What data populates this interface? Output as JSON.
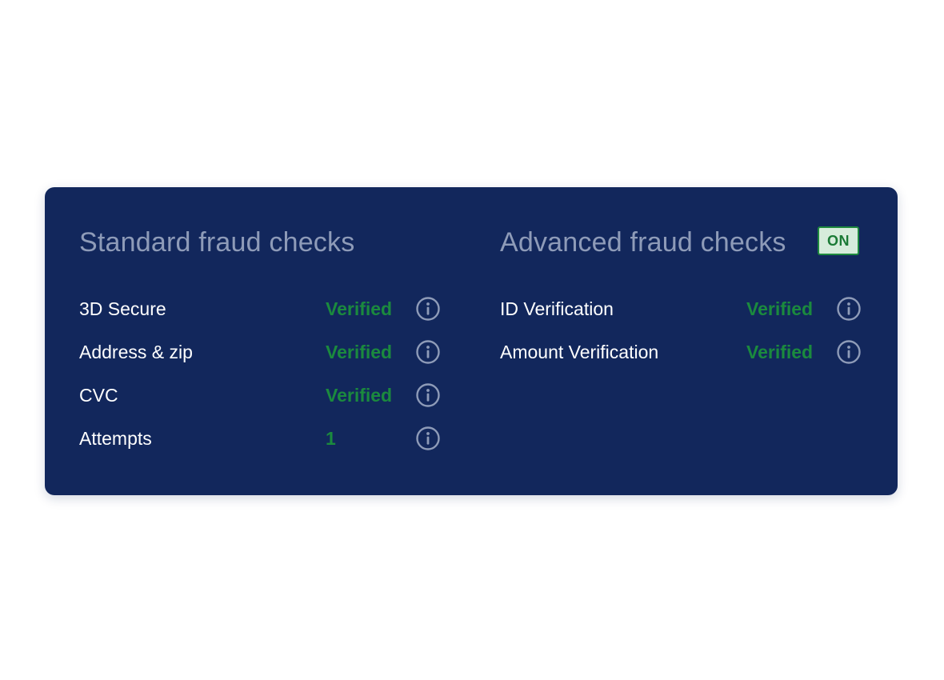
{
  "colors": {
    "card_background": "#12275c",
    "title_text": "#8e9bb8",
    "label_text": "#ffffff",
    "verified_green": "#1b8a3e",
    "toggle_background": "#d6ecdb",
    "toggle_border": "#1f8a3e",
    "info_icon": "#8e9bb8"
  },
  "standard": {
    "title": "Standard fraud checks",
    "rows": [
      {
        "label": "3D Secure",
        "value": "Verified",
        "icon": "info-icon"
      },
      {
        "label": "Address & zip",
        "value": "Verified",
        "icon": "info-icon"
      },
      {
        "label": "CVC",
        "value": "Verified",
        "icon": "info-icon"
      },
      {
        "label": "Attempts",
        "value": "1",
        "icon": "info-icon"
      }
    ]
  },
  "advanced": {
    "title": "Advanced fraud checks",
    "toggle_label": "ON",
    "rows": [
      {
        "label": "ID Verification",
        "value": "Verified",
        "icon": "info-icon"
      },
      {
        "label": "Amount Verification",
        "value": "Verified",
        "icon": "info-icon"
      }
    ]
  }
}
